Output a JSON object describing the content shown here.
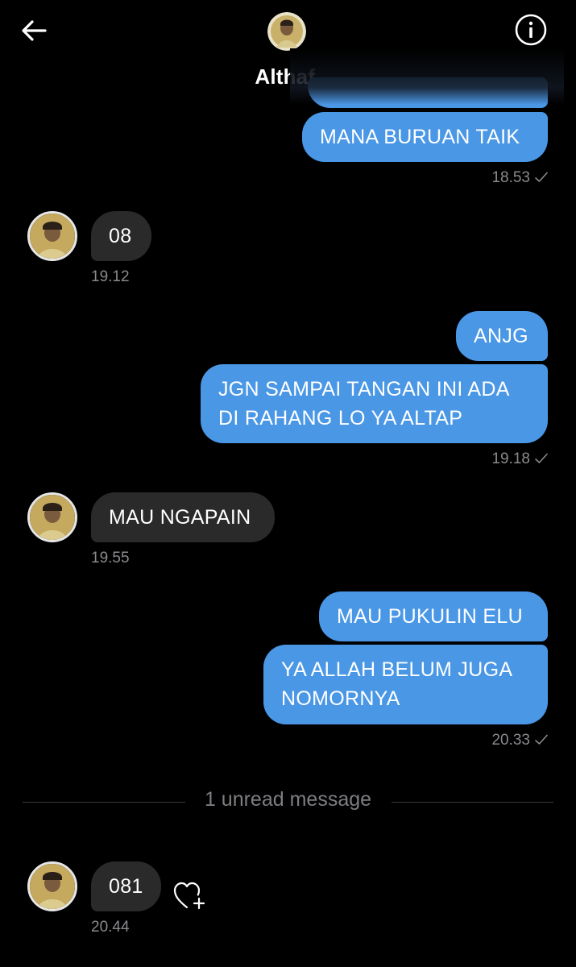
{
  "header": {
    "title": "Althaf.",
    "back_icon": "arrow-left-icon",
    "info_icon": "info-circle-icon"
  },
  "colors": {
    "sent_bubble": "#4a97e6",
    "received_bubble": "#2a2a2b",
    "background": "#000000",
    "timestamp": "#8a8a8e"
  },
  "messages": {
    "m1": {
      "text": "MANA BURUAN TAIK",
      "time": "18.53"
    },
    "m2": {
      "text": "08",
      "time": "19.12"
    },
    "m3": {
      "text": "ANJG"
    },
    "m4": {
      "line1": "JGN SAMPAI TANGAN INI ADA",
      "line2": "DI RAHANG LO YA ALTAP",
      "time": "19.18"
    },
    "m5": {
      "text": "MAU NGAPAIN",
      "time": "19.55"
    },
    "m6": {
      "text": "MAU PUKULIN ELU"
    },
    "m7": {
      "line1": "YA ALLAH BELUM JUGA",
      "line2": "NOMORNYA",
      "time": "20.33"
    },
    "unread_divider": "1 unread message",
    "m8": {
      "text": "081",
      "time": "20.44"
    }
  },
  "icons": {
    "check": "checkmark-icon",
    "heart_add": "heart-plus-icon",
    "avatar": "avatar-photo"
  }
}
